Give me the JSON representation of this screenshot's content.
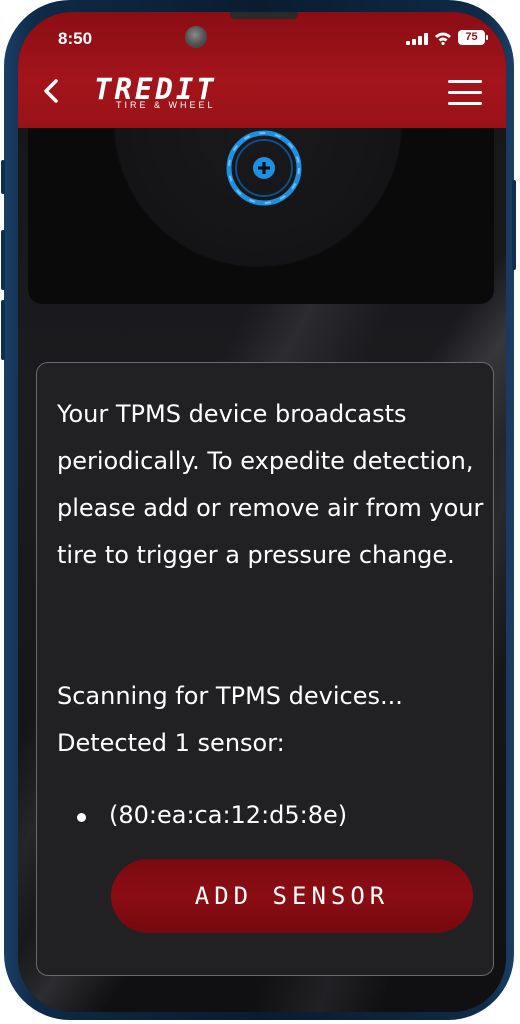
{
  "status_bar": {
    "time": "8:50",
    "battery": "75"
  },
  "header": {
    "logo_main": "TREDIT",
    "logo_sub": "TIRE & WHEEL"
  },
  "message": "Your TPMS device broadcasts periodically. To expedite detection, please add or remove air from your tire to trigger a pressure change.",
  "scan_status": "Scanning for TPMS devices... Detected 1 sensor:",
  "sensors": [
    {
      "label": "(80:ea:ca:12:d5:8e)"
    }
  ],
  "add_sensor_label": "ADD SENSOR",
  "colors": {
    "brand_red": "#a3141b",
    "plus_blue": "#1f8fe0"
  },
  "icons": [
    "back-chevron-icon",
    "hamburger-menu-icon",
    "add-circle-icon",
    "signal-icon",
    "wifi-icon",
    "battery-icon"
  ]
}
